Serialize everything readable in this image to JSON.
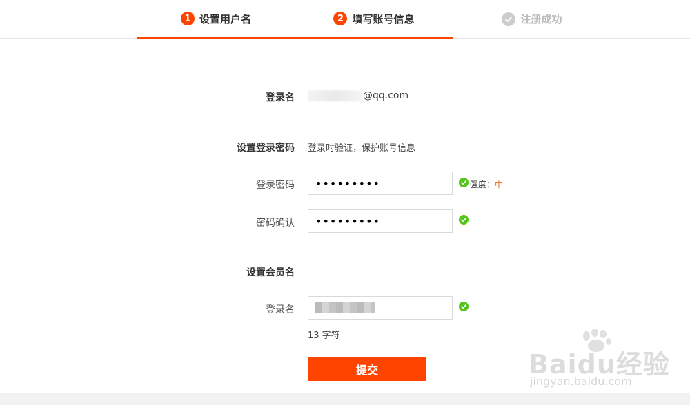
{
  "steps": [
    {
      "num": "1",
      "label": "设置用户名"
    },
    {
      "num": "2",
      "label": "填写账号信息"
    },
    {
      "label": "注册成功"
    }
  ],
  "account": {
    "login_name_label": "登录名",
    "login_name_value": "@qq.com"
  },
  "password_section": {
    "title": "设置登录密码",
    "description": "登录时验证，保护账号信息",
    "password_label": "登录密码",
    "password_value": "•••••••••",
    "strength_label": "强度：",
    "strength_level": "中",
    "confirm_label": "密码确认",
    "confirm_value": "•••••••••"
  },
  "member_section": {
    "title": "设置会员名",
    "login_label": "登录名",
    "char_count": "13 字符"
  },
  "submit_label": "提交",
  "watermark": {
    "logo": "Baidu经验",
    "url": "jingyan.baidu.com"
  },
  "colors": {
    "accent": "#ff4400",
    "success": "#52c41a",
    "inactive": "#cccccc",
    "strength_medium": "#ff6600"
  }
}
